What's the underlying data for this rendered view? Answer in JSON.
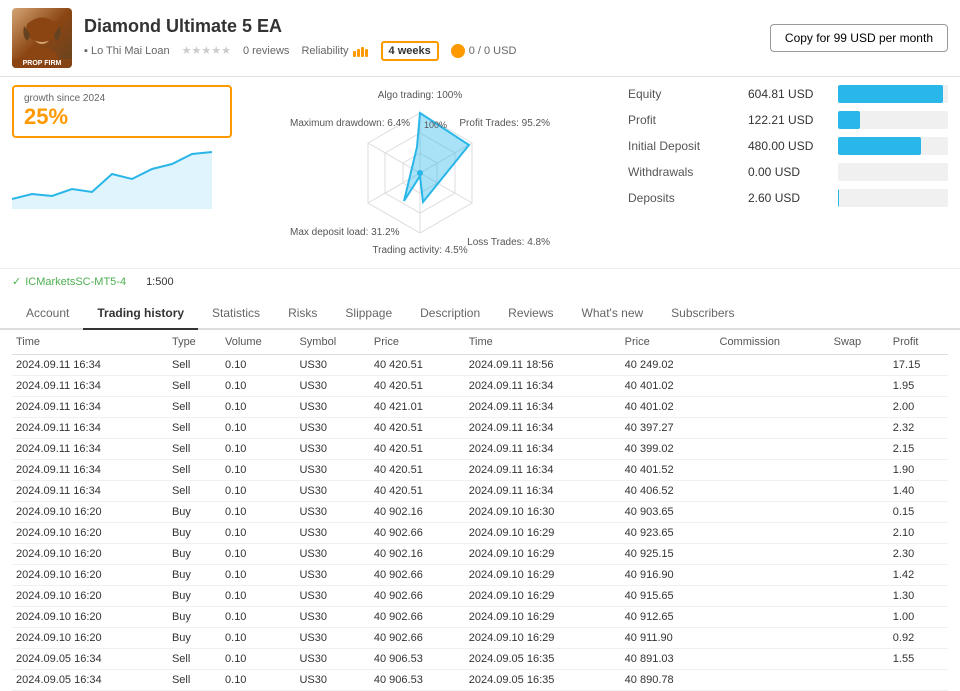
{
  "header": {
    "title": "Diamond Ultimate 5 EA",
    "author": "Lo Thi Mai Loan",
    "stars": "★★★★★",
    "reviews_count": "0 reviews",
    "reliability_label": "Reliability",
    "weeks": "4 weeks",
    "currency": "0 / 0 USD",
    "copy_button": "Copy for 99 USD per month"
  },
  "growth": {
    "label": "growth since 2024",
    "value": "25%"
  },
  "radar": {
    "algo_trading": "Algo trading: 100%",
    "profit_trades": "Profit Trades: 95.2%",
    "loss_trades": "Loss Trades: 4.8%",
    "trading_activity": "Trading activity: 4.5%",
    "max_deposit_load": "Max deposit load: 31.2%",
    "max_drawdown": "Maximum drawdown: 6.4%"
  },
  "stats": {
    "equity_label": "Equity",
    "equity_value": "604.81 USD",
    "equity_pct": 95,
    "profit_label": "Profit",
    "profit_value": "122.21 USD",
    "profit_pct": 20,
    "initial_label": "Initial Deposit",
    "initial_value": "480.00 USD",
    "initial_pct": 75,
    "withdrawals_label": "Withdrawals",
    "withdrawals_value": "0.00 USD",
    "withdrawals_pct": 0,
    "deposits_label": "Deposits",
    "deposits_value": "2.60 USD",
    "deposits_pct": 1
  },
  "broker": {
    "name": "ICMarketsSC-MT5-4",
    "leverage": "1:500"
  },
  "tabs": [
    {
      "label": "Account",
      "active": false
    },
    {
      "label": "Trading history",
      "active": true
    },
    {
      "label": "Statistics",
      "active": false
    },
    {
      "label": "Risks",
      "active": false
    },
    {
      "label": "Slippage",
      "active": false
    },
    {
      "label": "Description",
      "active": false
    },
    {
      "label": "Reviews",
      "active": false
    },
    {
      "label": "What's new",
      "active": false
    },
    {
      "label": "Subscribers",
      "active": false
    }
  ],
  "table": {
    "columns": [
      "Time",
      "Type",
      "Volume",
      "Symbol",
      "Price",
      "Time",
      "Price",
      "Commission",
      "Swap",
      "Profit"
    ],
    "rows": [
      [
        "2024.09.11 16:34",
        "Sell",
        "0.10",
        "US30",
        "40 420.51",
        "2024.09.11 18:56",
        "40 249.02",
        "",
        "",
        "17.15"
      ],
      [
        "2024.09.11 16:34",
        "Sell",
        "0.10",
        "US30",
        "40 420.51",
        "2024.09.11 16:34",
        "40 401.02",
        "",
        "",
        "1.95"
      ],
      [
        "2024.09.11 16:34",
        "Sell",
        "0.10",
        "US30",
        "40 421.01",
        "2024.09.11 16:34",
        "40 401.02",
        "",
        "",
        "2.00"
      ],
      [
        "2024.09.11 16:34",
        "Sell",
        "0.10",
        "US30",
        "40 420.51",
        "2024.09.11 16:34",
        "40 397.27",
        "",
        "",
        "2.32"
      ],
      [
        "2024.09.11 16:34",
        "Sell",
        "0.10",
        "US30",
        "40 420.51",
        "2024.09.11 16:34",
        "40 399.02",
        "",
        "",
        "2.15"
      ],
      [
        "2024.09.11 16:34",
        "Sell",
        "0.10",
        "US30",
        "40 420.51",
        "2024.09.11 16:34",
        "40 401.52",
        "",
        "",
        "1.90"
      ],
      [
        "2024.09.11 16:34",
        "Sell",
        "0.10",
        "US30",
        "40 420.51",
        "2024.09.11 16:34",
        "40 406.52",
        "",
        "",
        "1.40"
      ],
      [
        "2024.09.10 16:20",
        "Buy",
        "0.10",
        "US30",
        "40 902.16",
        "2024.09.10 16:30",
        "40 903.65",
        "",
        "",
        "0.15"
      ],
      [
        "2024.09.10 16:20",
        "Buy",
        "0.10",
        "US30",
        "40 902.66",
        "2024.09.10 16:29",
        "40 923.65",
        "",
        "",
        "2.10"
      ],
      [
        "2024.09.10 16:20",
        "Buy",
        "0.10",
        "US30",
        "40 902.16",
        "2024.09.10 16:29",
        "40 925.15",
        "",
        "",
        "2.30"
      ],
      [
        "2024.09.10 16:20",
        "Buy",
        "0.10",
        "US30",
        "40 902.66",
        "2024.09.10 16:29",
        "40 916.90",
        "",
        "",
        "1.42"
      ],
      [
        "2024.09.10 16:20",
        "Buy",
        "0.10",
        "US30",
        "40 902.66",
        "2024.09.10 16:29",
        "40 915.65",
        "",
        "",
        "1.30"
      ],
      [
        "2024.09.10 16:20",
        "Buy",
        "0.10",
        "US30",
        "40 902.66",
        "2024.09.10 16:29",
        "40 912.65",
        "",
        "",
        "1.00"
      ],
      [
        "2024.09.10 16:20",
        "Buy",
        "0.10",
        "US30",
        "40 902.66",
        "2024.09.10 16:29",
        "40 911.90",
        "",
        "",
        "0.92"
      ],
      [
        "2024.09.05 16:34",
        "Sell",
        "0.10",
        "US30",
        "40 906.53",
        "2024.09.05 16:35",
        "40 891.03",
        "",
        "",
        "1.55"
      ],
      [
        "2024.09.05 16:34",
        "Sell",
        "0.10",
        "US30",
        "40 906.53",
        "2024.09.05 16:35",
        "40 890.78",
        "",
        "",
        ""
      ]
    ]
  }
}
